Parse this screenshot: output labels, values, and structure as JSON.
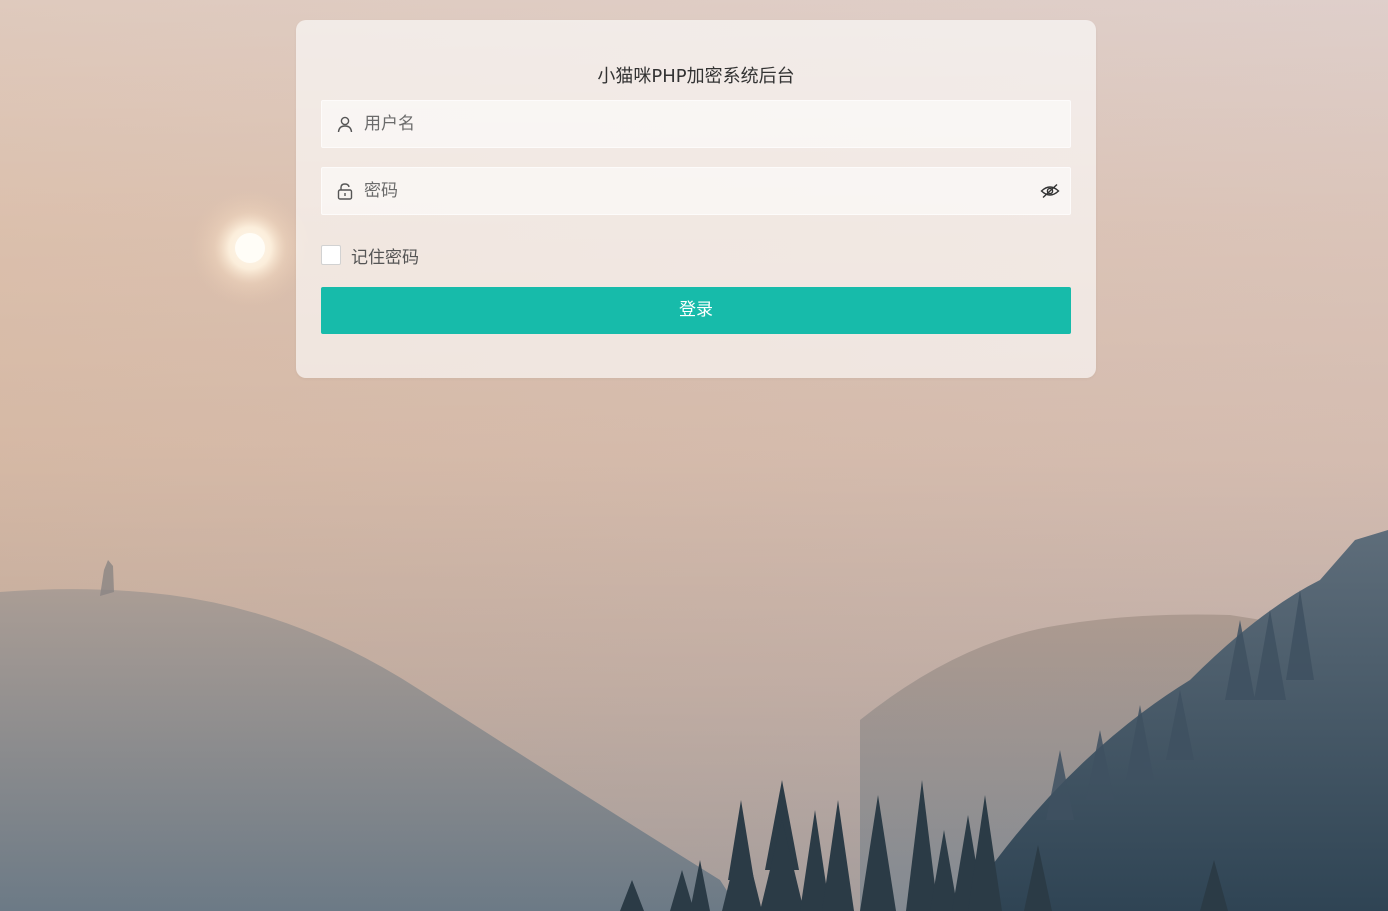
{
  "login": {
    "title": "小猫咪PHP加密系统后台",
    "username_placeholder": "用户名",
    "username_value": "",
    "password_placeholder": "密码",
    "password_value": "",
    "remember_label": "记住密码",
    "remember_checked": false,
    "submit_label": "登录"
  },
  "icons": {
    "username": "user-icon",
    "password": "lock-icon",
    "toggle_password": "eye-icon"
  },
  "colors": {
    "primary": "#17bbaa",
    "card_background": "rgba(255,255,255,0.62)"
  }
}
